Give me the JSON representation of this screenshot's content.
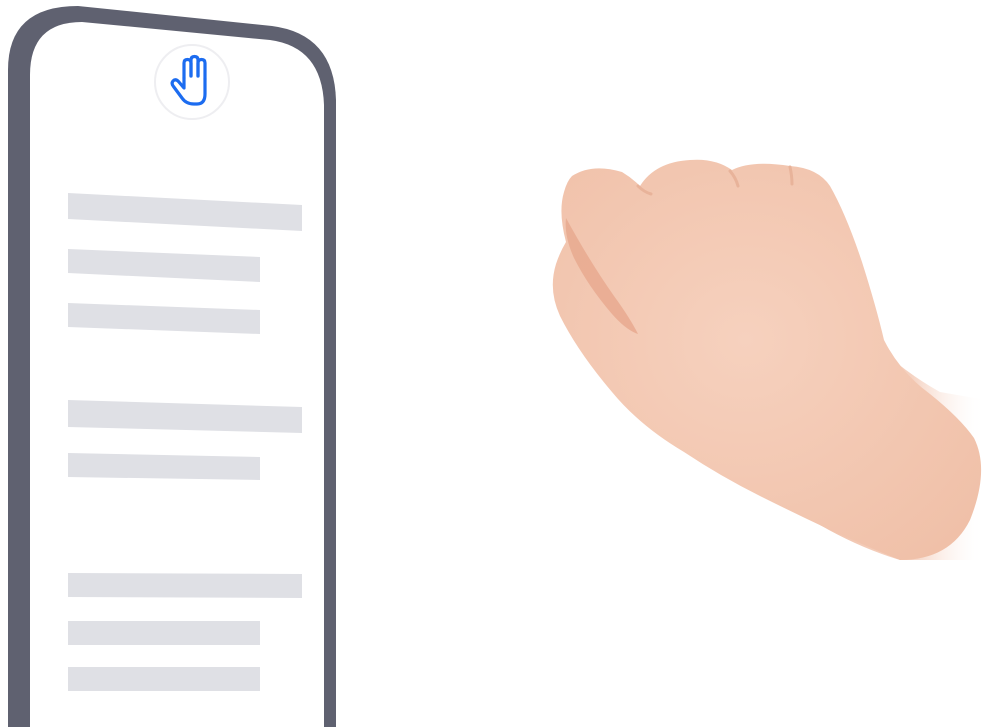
{
  "illustration": {
    "gesture_icon": "raised-hand-icon",
    "accent_color": "#1c6cf0",
    "phone_frame_color": "#5f6170",
    "placeholder_line_color": "#dfe0e5",
    "skin_color": "#f3c8b2",
    "content_line_count": 8,
    "scene_hand": "closed-fist"
  }
}
